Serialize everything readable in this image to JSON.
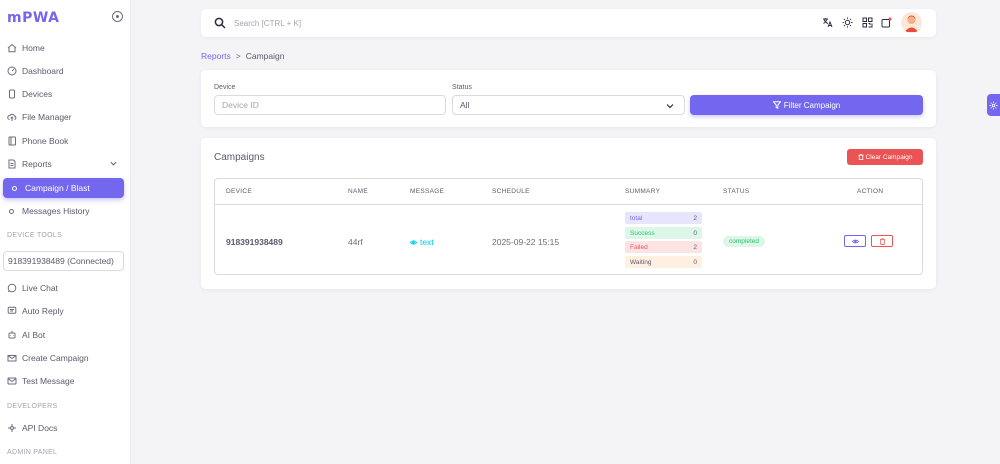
{
  "brand": {
    "logo_text": "mPWA"
  },
  "sidebar": {
    "items": [
      {
        "label": "Home",
        "icon": "home-icon"
      },
      {
        "label": "Dashboard",
        "icon": "gauge-icon"
      },
      {
        "label": "Devices",
        "icon": "phone-icon"
      },
      {
        "label": "File Manager",
        "icon": "cloud-upload-icon"
      },
      {
        "label": "Phone Book",
        "icon": "address-book-icon"
      },
      {
        "label": "Reports",
        "icon": "report-icon"
      }
    ],
    "reports_children": [
      {
        "label": "Campaign / Blast",
        "active": true
      },
      {
        "label": "Messages History",
        "active": false
      }
    ],
    "device_tools_label": "DEVICE TOOLS",
    "selected_device": "918391938489 (Connected)",
    "tools": [
      {
        "label": "Live Chat",
        "icon": "whatsapp-icon"
      },
      {
        "label": "Auto Reply",
        "icon": "message-square-icon"
      },
      {
        "label": "AI Bot",
        "icon": "robot-icon"
      },
      {
        "label": "Create Campaign",
        "icon": "mail-send-icon"
      },
      {
        "label": "Test Message",
        "icon": "mail-icon"
      }
    ],
    "developers_label": "DEVELOPERS",
    "developers": [
      {
        "label": "API Docs",
        "icon": "api-icon"
      }
    ],
    "admin_panel_label": "ADMIN PANEL"
  },
  "topbar": {
    "search_placeholder": "Search [CTRL + K]",
    "icons": [
      "translate-icon",
      "sun-icon",
      "qr-code-icon",
      "notification-icon"
    ]
  },
  "breadcrumb": {
    "parent": "Reports",
    "current": "Campaign"
  },
  "filter": {
    "device_label": "Device",
    "device_placeholder": "Device ID",
    "status_label": "Status",
    "status_value": "All",
    "button_label": "Filter Campaign"
  },
  "campaigns": {
    "title": "Campaigns",
    "clear_button": "Clear Campaign",
    "columns": [
      "DEVICE",
      "NAME",
      "MESSAGE",
      "SCHEDULE",
      "SUMMARY",
      "STATUS",
      "ACTION"
    ],
    "rows": [
      {
        "device": "918391938489",
        "name": "44rf",
        "message": "text",
        "schedule": "2025-09-22 15:15",
        "summary": {
          "total_label": "total",
          "total": "2",
          "success_label": "Success",
          "success": "0",
          "failed_label": "Failed",
          "failed": "2",
          "waiting_label": "Waiting",
          "waiting": "0"
        },
        "status": "completed"
      }
    ]
  },
  "colors": {
    "primary": "#7367f0",
    "danger": "#ea5455",
    "success": "#28c76f",
    "info": "#00cfe8"
  }
}
